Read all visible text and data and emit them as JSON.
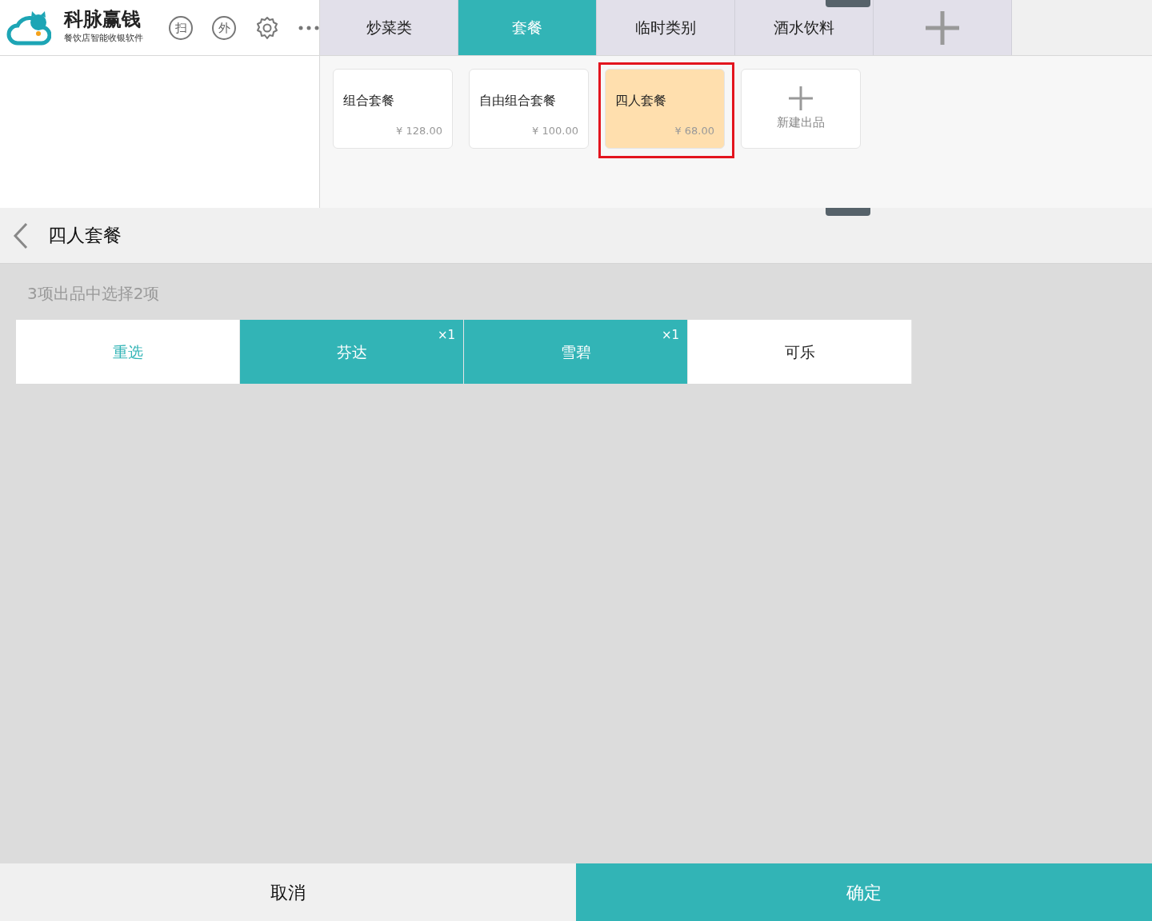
{
  "header": {
    "brand": "科脉赢钱",
    "tagline": "餐饮店智能收银软件",
    "round_buttons": [
      "扫",
      "外"
    ]
  },
  "category_tabs": [
    {
      "label": "炒菜类",
      "selected": false
    },
    {
      "label": "套餐",
      "selected": true
    },
    {
      "label": "临时类别",
      "selected": false
    },
    {
      "label": "酒水饮料",
      "selected": false
    }
  ],
  "products": [
    {
      "name": "组合套餐",
      "price": "¥ 128.00",
      "selected": false
    },
    {
      "name": "自由组合套餐",
      "price": "¥ 100.00",
      "selected": false
    },
    {
      "name": "四人套餐",
      "price": "¥ 68.00",
      "selected": true
    }
  ],
  "new_product": {
    "label": "新建出品"
  },
  "detail": {
    "title": "四人套餐",
    "hint": "3项出品中选择2项",
    "options": [
      {
        "kind": "reset",
        "label": "重选"
      },
      {
        "kind": "item",
        "label": "芬达",
        "selected": true,
        "count": "×1"
      },
      {
        "kind": "item",
        "label": "雪碧",
        "selected": true,
        "count": "×1"
      },
      {
        "kind": "item",
        "label": "可乐",
        "selected": false
      }
    ]
  },
  "footer": {
    "cancel": "取消",
    "confirm": "确定"
  }
}
